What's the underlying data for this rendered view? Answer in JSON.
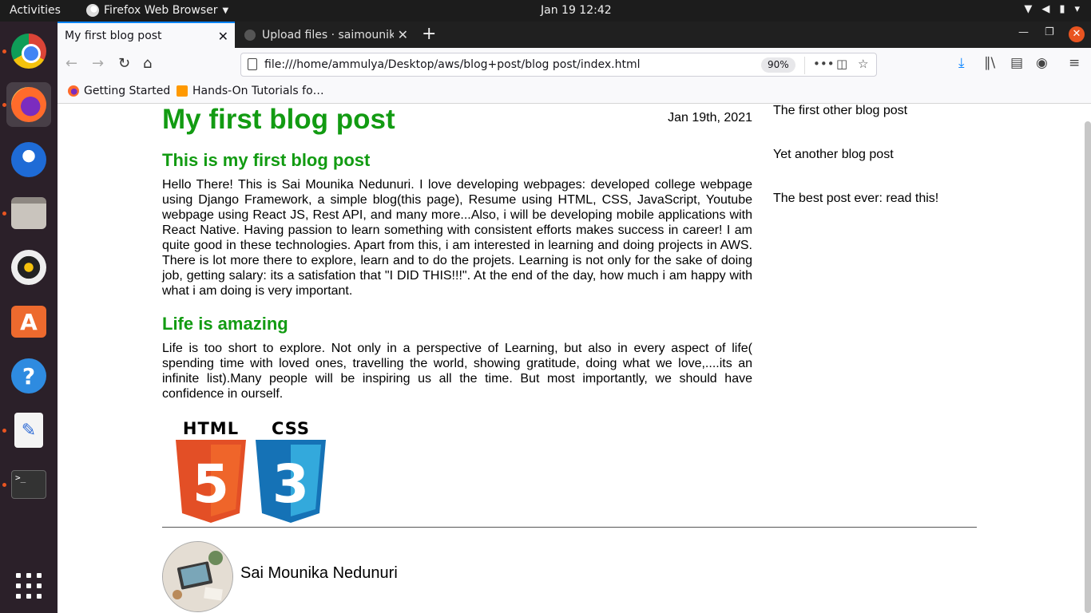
{
  "system": {
    "activities": "Activities",
    "app_menu": "Firefox Web Browser",
    "clock": "Jan 19  12:42"
  },
  "browser": {
    "tabs": [
      {
        "title": "My first blog post",
        "active": true
      },
      {
        "title": "Upload files · saimounika",
        "active": false
      }
    ],
    "url": "file:///home/ammulya/Desktop/aws/blog+post/blog post/index.html",
    "zoom": "90%",
    "bookmarks": [
      "Getting Started",
      "Hands-On Tutorials fo…"
    ]
  },
  "page": {
    "title": "My first blog post",
    "date": "Jan 19th, 2021",
    "sections": [
      {
        "heading": "This is my first blog post",
        "body": "Hello There! This is Sai Mounika Nedunuri. I love developing webpages: developed college webpage using Django Framework, a simple blog(this page), Resume using HTML, CSS, JavaScript, Youtube webpage using React JS, Rest API, and many more...Also, i will be developing mobile applications with React Native. Having passion to learn something with consistent efforts makes success in career! I am quite good in these technologies. Apart from this, i am interested in learning and doing projects in AWS. There is lot more there to explore, learn and to do the projets. Learning is not only for the sake of doing job, getting salary: its a satisfation that \"I DID THIS!!!\". At the end of the day, how much i am happy with what i am doing is very important."
      },
      {
        "heading": "Life is amazing",
        "body": "Life is too short to explore. Not only in a perspective of Learning, but also in every aspect of life( spending time with loved ones, travelling the world, showing gratitude, doing what we love,....its an infinite list).Many people will be inspiring us all the time. But most importantly, we should have confidence in ourself."
      }
    ],
    "logos": [
      {
        "label": "HTML",
        "digit": "5",
        "color": "#e34f26",
        "shade": "#ef652a"
      },
      {
        "label": "CSS",
        "digit": "3",
        "color": "#1572b6",
        "shade": "#33a9dc"
      }
    ],
    "sidebar_links": [
      "The first other blog post",
      "Yet another blog post",
      "The best post ever: read this!"
    ],
    "author": "Sai Mounika Nedunuri"
  }
}
